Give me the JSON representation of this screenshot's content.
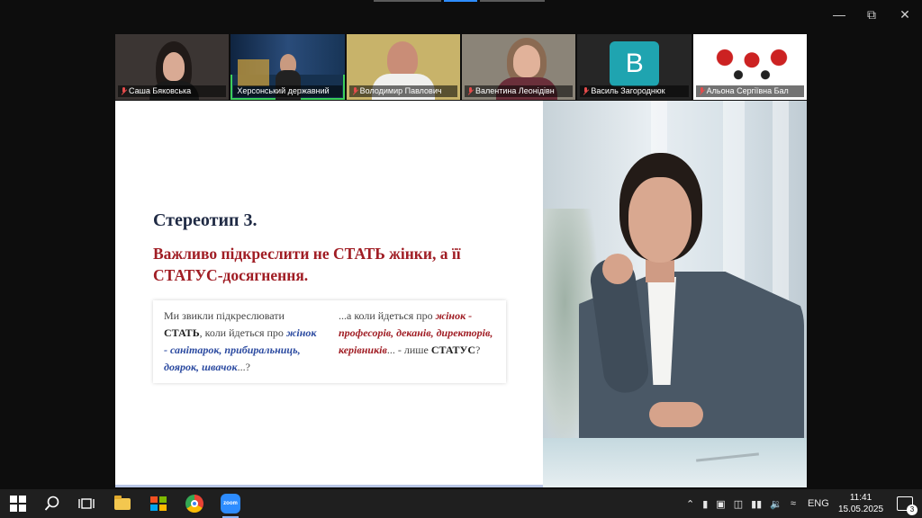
{
  "participants": [
    {
      "name": "Саша Бяковська",
      "muted": true
    },
    {
      "name": "Херсонський державний",
      "muted": false,
      "active": true
    },
    {
      "name": "Володимир Павлович",
      "muted": true
    },
    {
      "name": "Валентина Леонідівн",
      "muted": true
    },
    {
      "name": "Василь Загороднюк",
      "muted": true,
      "avatar_letter": "B"
    },
    {
      "name": "Альона Сергіївна Бал",
      "muted": true
    }
  ],
  "slide": {
    "title": "Стереотип 3.",
    "subtitle": "Важливо підкреслити не СТАТЬ жінки, а її СТАТУС-досягнення.",
    "left_box": {
      "t1": "Ми звикли підкреслювати",
      "t2": "СТАТЬ",
      "t3": ", коли йдеться про ",
      "t4": "жінок - санітарок, прибиральниць, доярок, швачок",
      "t5": "...?"
    },
    "right_box": {
      "t1": "...а коли йдеться про ",
      "t2": "жінок - професорів, деканів, директорів, керівників",
      "t3": "... - лише ",
      "t4": "СТАТУС",
      "t5": "?"
    }
  },
  "taskbar": {
    "language": "ENG",
    "time": "11:41",
    "date": "15.05.2025",
    "notifications": "3",
    "zoom_label": "zoom"
  },
  "colors": {
    "title": "#1f2a44",
    "accent_red": "#a01d24",
    "accent_blue": "#2b4aa0",
    "active_speaker": "#3ccf5b",
    "avatar_bg": "#1fa4b0"
  }
}
